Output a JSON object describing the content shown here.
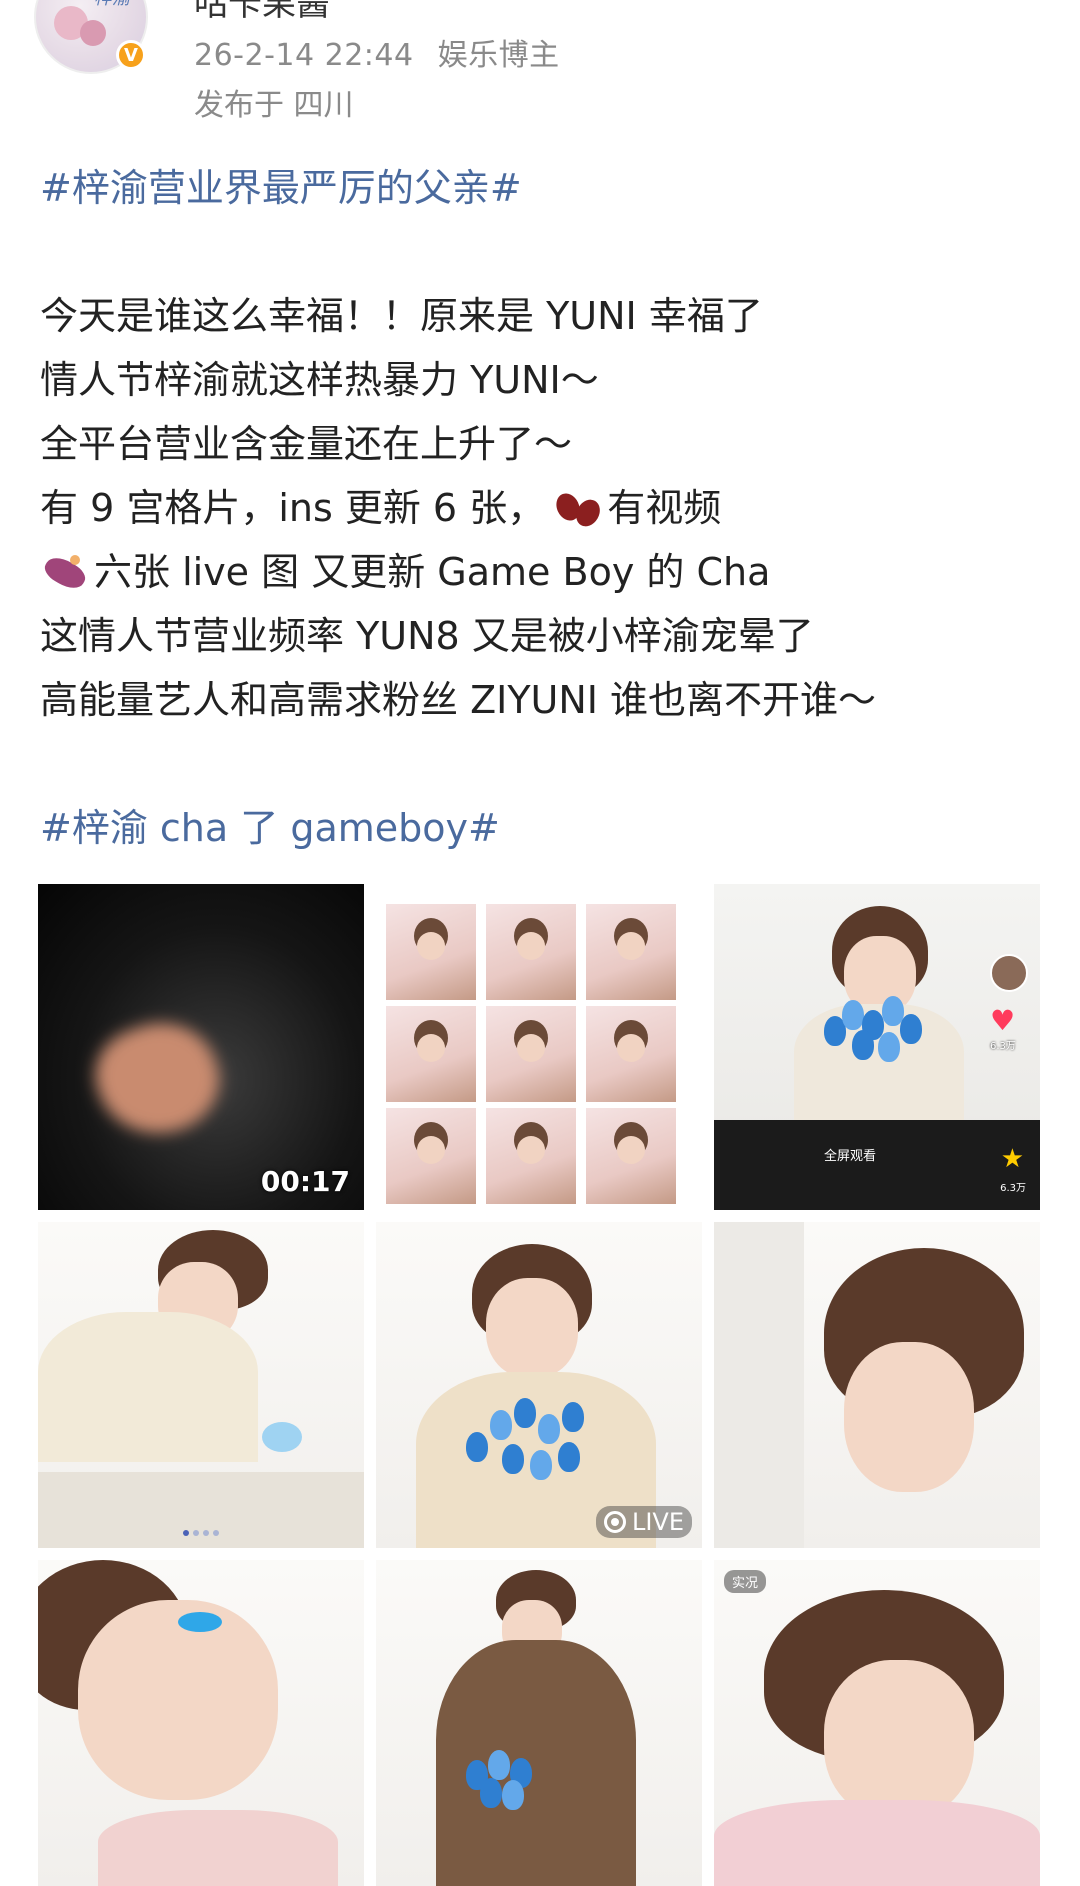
{
  "post": {
    "username": "咕卡果酱",
    "date": "26-2-14 22:44",
    "role": "娱乐博主",
    "location": "发布于 四川",
    "verified_badge": "V",
    "hashtag_top": "#梓渝营业界最严厉的父亲#",
    "lines": [
      "今天是谁这么幸福！！原来是 YUNI 幸福了",
      "情人节梓渝就这样热暴力 YUNI～",
      "全平台营业含金量还在上升了～"
    ],
    "line4_a": "有 9 宫格片，ins 更新 6 张，",
    "line4_b": "有视频",
    "line5": "六张 live 图  又更新 Game Boy 的 Cha",
    "line6": "这情人节营业频率 YUN8 又是被小梓渝宠晕了",
    "line7": "高能量艺人和高需求粉丝  ZIYUNI 谁也离不开谁～",
    "hashtag_bottom": "#梓渝 cha 了 gameboy#",
    "colors": {
      "hashtag": "#4a6a9e",
      "meta": "#8a8a8a",
      "badge": "#f7a11b"
    }
  },
  "media": {
    "video_duration": "00:17",
    "fullscreen_label": "全屏观看",
    "like_count": "6.3万",
    "star_count": "6.3万",
    "live_label": "LIVE",
    "chip_label": "实况"
  }
}
